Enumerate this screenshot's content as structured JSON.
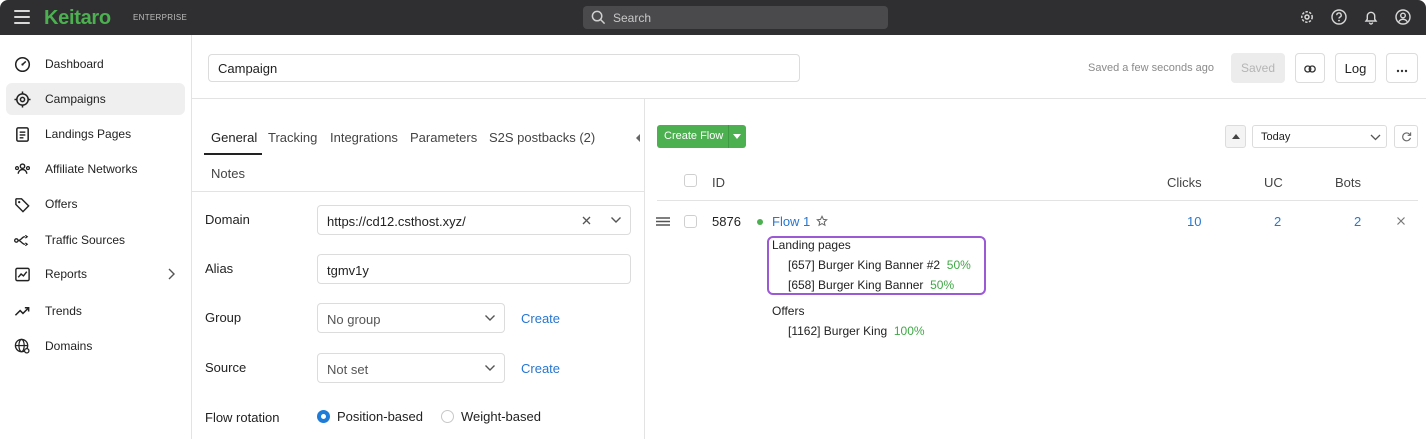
{
  "topbar": {
    "logo": "Keitaro",
    "edition": "ENTERPRISE",
    "search_placeholder": "Search"
  },
  "sidebar": {
    "items": [
      {
        "label": "Dashboard",
        "icon": "dashboard-icon"
      },
      {
        "label": "Campaigns",
        "icon": "target-icon",
        "active": true
      },
      {
        "label": "Landings Pages",
        "icon": "page-icon"
      },
      {
        "label": "Affiliate Networks",
        "icon": "people-icon"
      },
      {
        "label": "Offers",
        "icon": "tag-icon"
      },
      {
        "label": "Traffic Sources",
        "icon": "route-icon"
      },
      {
        "label": "Reports",
        "icon": "chart-icon"
      },
      {
        "label": "Trends",
        "icon": "trend-icon"
      },
      {
        "label": "Domains",
        "icon": "globe-icon"
      }
    ]
  },
  "header": {
    "campaign_name": "Campaign",
    "saved_status": "Saved a few seconds ago",
    "saved_button": "Saved",
    "log_button": "Log"
  },
  "tabs": [
    "General",
    "Tracking",
    "Integrations",
    "Parameters",
    "S2S postbacks (2)",
    "Notes"
  ],
  "form": {
    "domain_label": "Domain",
    "domain_value": "https://cd12.csthost.xyz/",
    "alias_label": "Alias",
    "alias_value": "tgmv1y",
    "group_label": "Group",
    "group_value": "No group",
    "group_create": "Create",
    "source_label": "Source",
    "source_value": "Not set",
    "source_create": "Create",
    "rotation_label": "Flow rotation",
    "rotation_options": [
      "Position-based",
      "Weight-based"
    ],
    "rotation_selected": "Position-based"
  },
  "flows": {
    "create_button": "Create Flow",
    "date_range": "Today",
    "columns": {
      "id": "ID",
      "clicks": "Clicks",
      "uc": "UC",
      "bots": "Bots"
    },
    "row": {
      "id": "5876",
      "name": "Flow 1",
      "clicks": "10",
      "uc": "2",
      "bots": "2",
      "status_color": "#4caf50",
      "landing_title": "Landing pages",
      "landings": [
        {
          "name": "[657] Burger King Banner #2",
          "share": "50%"
        },
        {
          "name": "[658] Burger King Banner",
          "share": "50%"
        }
      ],
      "offers_title": "Offers",
      "offers": [
        {
          "name": "[1162] Burger King",
          "share": "100%"
        }
      ]
    }
  },
  "colors": {
    "brand": "#4caf50",
    "link": "#2677d1",
    "highlight": "#9b59d6",
    "topbar": "#2f2f31"
  }
}
